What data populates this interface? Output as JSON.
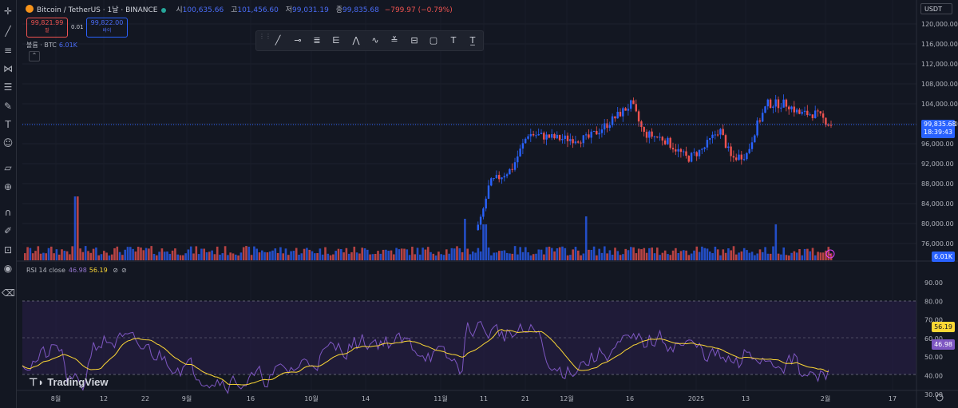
{
  "header": {
    "symbol": "Bitcoin / TetherUS · 1날 · BINANCE",
    "open_label": "시",
    "open": "100,635.66",
    "high_label": "고",
    "high": "101,456.60",
    "low_label": "저",
    "low": "99,031.19",
    "close_label": "종",
    "close": "99,835.68",
    "change": "−799.97 (−0.79%)"
  },
  "trade": {
    "sell_price": "99,821.99",
    "sell_label": "팔",
    "spread": "0.01",
    "buy_price": "99,822.00",
    "buy_label": "바이"
  },
  "volume_legend": {
    "label": "볼륨 · BTC",
    "value": "6.01K"
  },
  "currency": "USDT",
  "price_axis": [
    "120,000.00",
    "116,000.00",
    "112,000.00",
    "108,000.00",
    "104,000.00",
    "100,000.00",
    "96,000.00",
    "92,000.00",
    "88,000.00",
    "84,000.00",
    "80,000.00",
    "76,000.00"
  ],
  "price_tag": {
    "price": "99,835.68",
    "countdown": "18:39:43",
    "volume": "6.01K"
  },
  "rsi": {
    "label": "RSI 14 close",
    "value": "46.98",
    "ma": "56.19"
  },
  "rsi_axis": [
    "90.00",
    "80.00",
    "70.00",
    "60.00",
    "50.00",
    "40.00",
    "30.00"
  ],
  "time_axis": [
    "8월",
    "12",
    "22",
    "9월",
    "16",
    "10월",
    "14",
    "11월",
    "11",
    "21",
    "12월",
    "16",
    "2025",
    "13",
    "2월",
    "17"
  ],
  "brand": "TradingView",
  "colors": {
    "up": "#2962ff",
    "down": "#ef5350",
    "rsi": "#7e57c2",
    "rsi_ma": "#fdd835",
    "bg": "#131722"
  },
  "left_toolbar_icons": [
    "crosshair-icon",
    "trend-line-icon",
    "horizontal-lines-icon",
    "pitchfork-icon",
    "fib-icon",
    "brush-icon",
    "text-icon",
    "emoji-icon",
    "ruler-icon",
    "zoom-icon",
    "magnet-icon",
    "lock-draw-icon",
    "lock-icon",
    "eye-icon",
    "trash-icon"
  ],
  "drawing_toolbar_icons": [
    "ray-icon",
    "horizontal-ray-icon",
    "parallel-channel-icon",
    "regression-icon",
    "pattern-icon",
    "elliott-icon",
    "projection-icon",
    "range-icon",
    "rectangle-icon",
    "text-tool-icon",
    "text-note-icon"
  ]
}
